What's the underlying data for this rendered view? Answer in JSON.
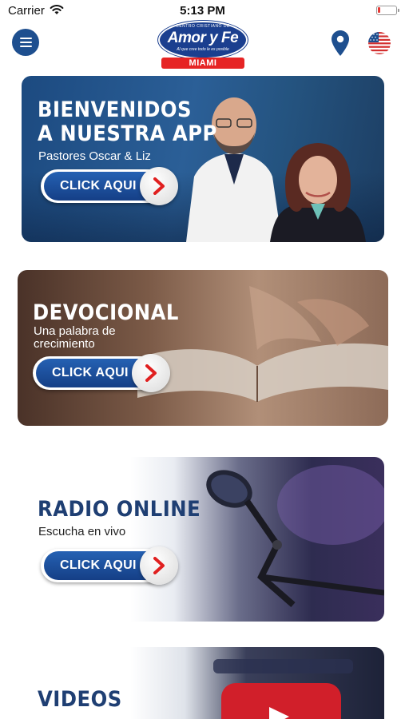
{
  "status_bar": {
    "carrier": "Carrier",
    "time": "5:13 PM",
    "battery_level": 0.12,
    "battery_color": "#e53935"
  },
  "header": {
    "menu_icon": "hamburger-menu-icon",
    "logo": {
      "top_text": "CENTRO CRISTIANO DE",
      "main_text": "Amor y Fe",
      "tagline": "Al que cree todo le es posible",
      "city": "MIAMI"
    },
    "location_icon": "map-pin-icon",
    "language_icon": "us-flag-icon"
  },
  "colors": {
    "brand_blue": "#1e4f8f",
    "brand_red": "#e62424",
    "title_blue": "#1f3f73"
  },
  "cards": [
    {
      "title_line1": "BIENVENIDOS",
      "title_line2": "A NUESTRA APP",
      "subtitle": "Pastores Oscar &  Liz",
      "button": "CLICK AQUI"
    },
    {
      "title_line1": "DEVOCIONAL",
      "subtitle_line1": "Una palabra de",
      "subtitle_line2": "crecimiento",
      "button": "CLICK AQUI"
    },
    {
      "title_line1": "RADIO ONLINE",
      "subtitle": "Escucha en vivo",
      "button": "CLICK AQUI"
    },
    {
      "title_line1": "VIDEOS"
    }
  ]
}
